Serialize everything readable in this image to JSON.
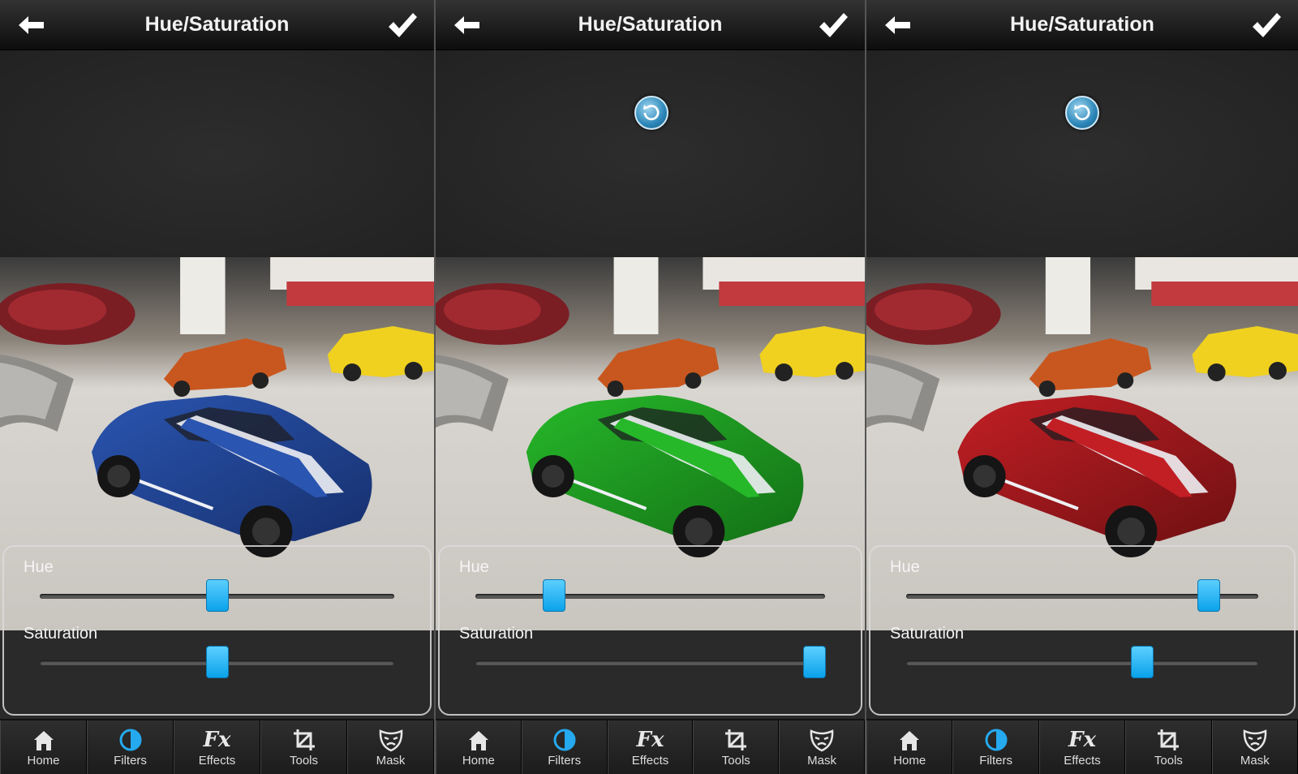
{
  "panels": [
    {
      "id": "panel-1",
      "title": "Hue/Saturation",
      "show_reset": false,
      "car_color": "#2a55b0",
      "car_shade": "#17306e",
      "sliders": {
        "hue_label": "Hue",
        "hue_value": 0.5,
        "saturation_label": "Saturation",
        "saturation_value": 0.5
      }
    },
    {
      "id": "panel-2",
      "title": "Hue/Saturation",
      "show_reset": true,
      "car_color": "#27b82a",
      "car_shade": "#137016",
      "sliders": {
        "hue_label": "Hue",
        "hue_value": 0.225,
        "saturation_label": "Saturation",
        "saturation_value": 0.97
      }
    },
    {
      "id": "panel-3",
      "title": "Hue/Saturation",
      "show_reset": true,
      "car_color": "#c21f25",
      "car_shade": "#701012",
      "sliders": {
        "hue_label": "Hue",
        "hue_value": 0.86,
        "saturation_label": "Saturation",
        "saturation_value": 0.67
      }
    }
  ],
  "nav": [
    {
      "label": "Home",
      "icon": "home-icon"
    },
    {
      "label": "Filters",
      "icon": "filters-icon"
    },
    {
      "label": "Effects",
      "icon": "effects-icon",
      "glyph": "Fx"
    },
    {
      "label": "Tools",
      "icon": "crop-icon"
    },
    {
      "label": "Mask",
      "icon": "mask-icon"
    }
  ],
  "colors": {
    "accent": "#1aa9f0",
    "topbar": "#111111",
    "background": "#2a2a2a"
  }
}
